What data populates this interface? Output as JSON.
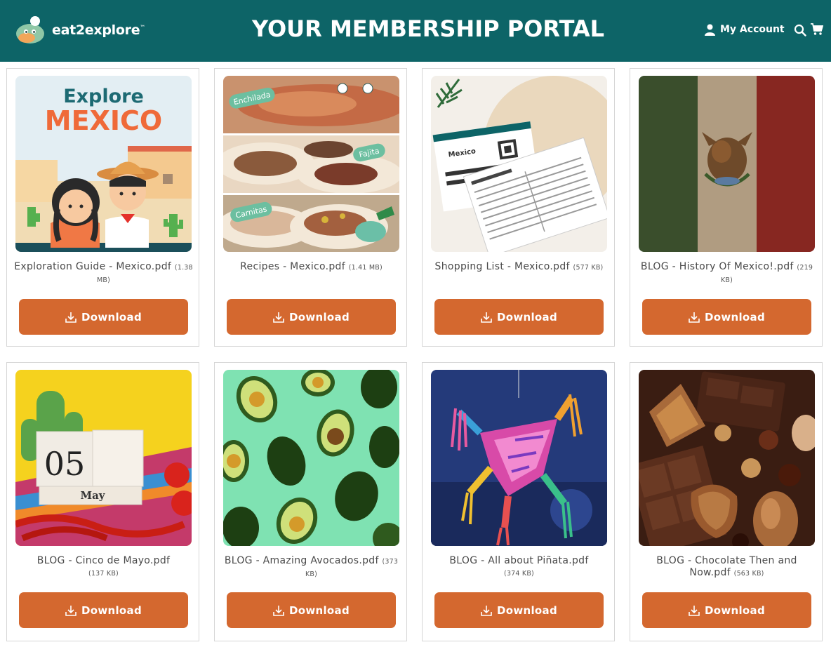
{
  "header": {
    "brand": "eat2explore",
    "brand_tm": "™",
    "title": "YOUR MEMBERSHIP PORTAL",
    "account_label": "My Account",
    "background": "#0d6467"
  },
  "accent_color": "#d4682f",
  "download_label": "Download",
  "cards": [
    {
      "title": "Exploration Guide - Mexico.pdf",
      "size": "(1.38 MB)",
      "thumb_text_top": "Explore",
      "thumb_text_main": "MEXICO"
    },
    {
      "title": "Recipes - Mexico.pdf",
      "size": "(1.41 MB)",
      "labels": [
        "Enchilada",
        "Fajita",
        "Carnitas"
      ]
    },
    {
      "title": "Shopping List - Mexico.pdf",
      "size": "(577 KB)",
      "thumb_text": "Mexico"
    },
    {
      "title": "BLOG - History Of Mexico!.pdf",
      "size": "(219 KB)"
    },
    {
      "title": "BLOG - Cinco de Mayo.pdf",
      "size": "(137 KB)",
      "thumb_day": "05",
      "thumb_month": "May"
    },
    {
      "title": "BLOG - Amazing Avocados.pdf",
      "size": "(373 KB)"
    },
    {
      "title": "BLOG - All about Piñata.pdf",
      "size": "(374 KB)"
    },
    {
      "title": "BLOG - Chocolate Then and Now.pdf",
      "size": "(563 KB)"
    }
  ]
}
